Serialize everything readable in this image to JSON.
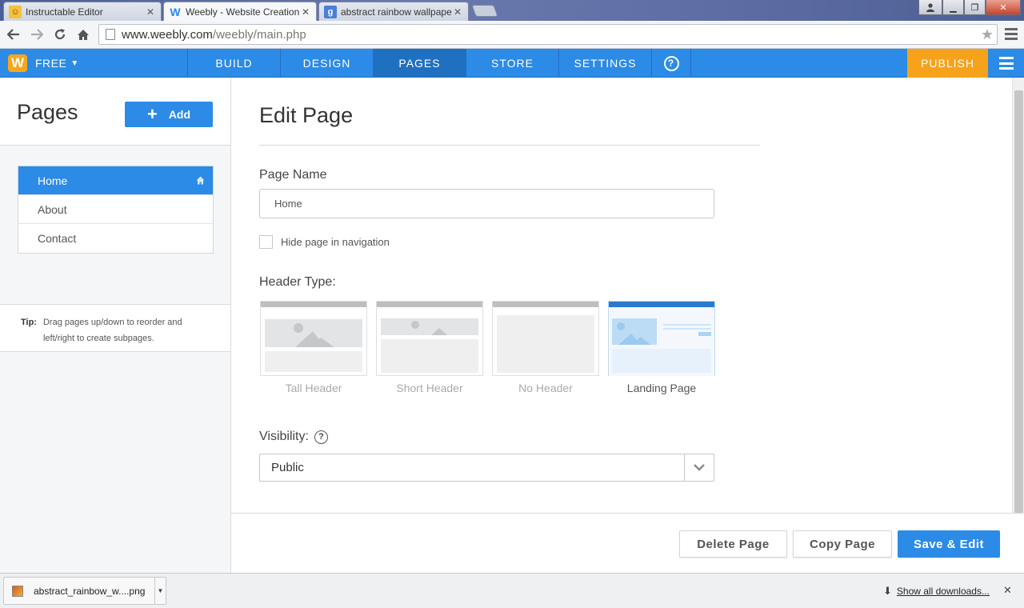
{
  "browser": {
    "tabs": [
      {
        "title": "Instructable Editor",
        "favicon": "robot-icon"
      },
      {
        "title": "Weebly - Website Creation",
        "favicon": "weebly-icon"
      },
      {
        "title": "abstract rainbow wallpaper",
        "favicon": "google-icon"
      }
    ],
    "url_host": "www.weebly.com",
    "url_path": "/weebly/main.php"
  },
  "app": {
    "logo_letter": "W",
    "plan_label": "FREE",
    "nav": [
      "BUILD",
      "DESIGN",
      "PAGES",
      "STORE",
      "SETTINGS"
    ],
    "active_nav": "PAGES",
    "help_label": "?",
    "publish_label": "PUBLISH",
    "accent_color": "#2b8be6",
    "publish_color": "#f7a21b"
  },
  "sidebar": {
    "title": "Pages",
    "add_label": "Add",
    "pages": [
      {
        "label": "Home",
        "active": true
      },
      {
        "label": "About",
        "active": false
      },
      {
        "label": "Contact",
        "active": false
      }
    ],
    "tip_label": "Tip:",
    "tip_text": "Drag pages up/down to reorder and left/right to create subpages."
  },
  "edit": {
    "title": "Edit Page",
    "page_name_label": "Page Name",
    "page_name_value": "Home",
    "hide_nav_label": "Hide page in navigation",
    "hide_nav_checked": false,
    "header_type_label": "Header Type:",
    "header_types": [
      {
        "label": "Tall Header",
        "selected": false
      },
      {
        "label": "Short Header",
        "selected": false
      },
      {
        "label": "No Header",
        "selected": false
      },
      {
        "label": "Landing Page",
        "selected": true
      }
    ],
    "visibility_label": "Visibility:",
    "visibility_help": "?",
    "visibility_value": "Public"
  },
  "footer": {
    "delete_label": "Delete Page",
    "copy_label": "Copy Page",
    "save_label": "Save & Edit"
  },
  "downloads": {
    "file_name": "abstract_rainbow_w....png",
    "show_all_label": "Show all downloads..."
  }
}
